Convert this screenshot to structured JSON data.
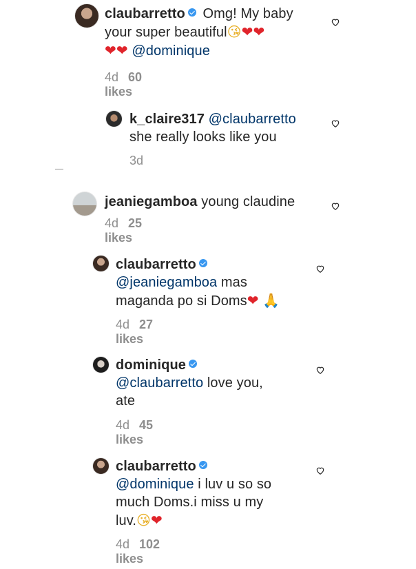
{
  "comments": [
    {
      "username": "claubarretto",
      "verified": true,
      "line1": " Omg! My baby",
      "line2": "your super beautiful",
      "line3_mention": "@dominique",
      "time": "4d",
      "likes": "60 likes"
    },
    {
      "username": "k_claire317",
      "mention": "@claubarretto",
      "line2": "she really looks like you",
      "time": "3d"
    },
    {
      "username": "jeaniegamboa",
      "line1": " young claudine",
      "time": "4d",
      "likes": "25 likes"
    },
    {
      "username": "claubarretto",
      "verified": true,
      "mention": "@jeaniegamboa",
      "line1": " mas",
      "line2": "maganda po si Doms",
      "time": "4d",
      "likes": "27 likes"
    },
    {
      "username": "dominique",
      "verified": true,
      "mention": "@claubarretto",
      "line1": " love you,",
      "line2": "ate",
      "time": "4d",
      "likes": "45 likes"
    },
    {
      "username": "claubarretto",
      "verified": true,
      "mention": "@dominique",
      "line1": " i luv u so so",
      "line2": "much Doms.i miss u my",
      "line3": "luv.",
      "time": "4d",
      "likes": "102 likes"
    }
  ],
  "icons": {
    "verified": "verified-badge-icon",
    "like": "heart-outline-icon",
    "emoji_kiss": "face-blowing-kiss-emoji",
    "emoji_heart": "red-heart-emoji",
    "emoji_pray": "folded-hands-emoji"
  },
  "colors": {
    "mention": "#003569",
    "meta": "#8e8e8e",
    "verified": "#3897f0",
    "heart": "#e0242b"
  }
}
